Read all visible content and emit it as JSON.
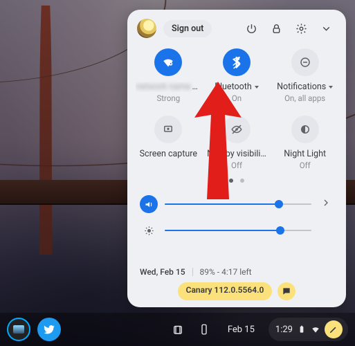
{
  "header": {
    "signout_label": "Sign out"
  },
  "tiles": {
    "wifi": {
      "label": "…",
      "sub": "Strong",
      "on": true
    },
    "bluetooth": {
      "label": "Bluetooth",
      "sub": "On",
      "on": true
    },
    "notifications": {
      "label": "Notifications",
      "sub": "On, all apps",
      "on": false
    },
    "screencap": {
      "label": "Screen capture",
      "sub": ""
    },
    "nearby": {
      "label": "Nearby visibili…",
      "sub": "Off"
    },
    "nightlight": {
      "label": "Night Light",
      "sub": "Off"
    }
  },
  "sliders": {
    "volume": {
      "percent": 78
    },
    "brightness": {
      "percent": 79
    }
  },
  "footer": {
    "date": "Wed, Feb 15",
    "battery_text": "89% - 4:17 left",
    "version": "Canary 112.0.5564.0"
  },
  "shelf": {
    "date": "Feb 15",
    "time": "1:29"
  }
}
